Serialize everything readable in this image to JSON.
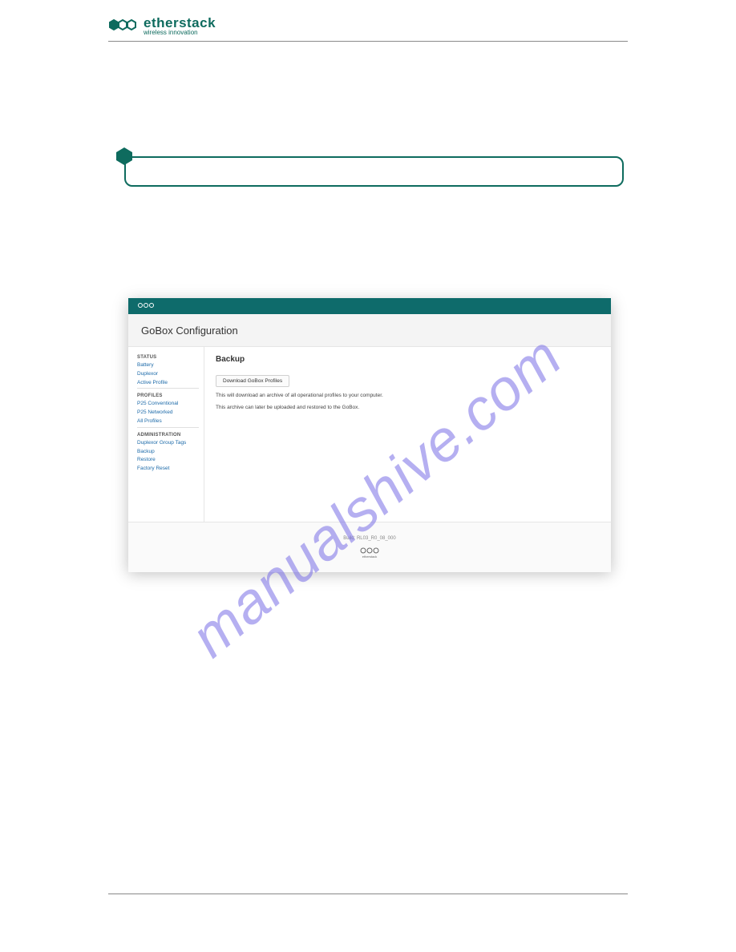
{
  "header": {
    "brand_main": "etherstack",
    "brand_sub": "wireless innovation"
  },
  "callout": {
    "text": ""
  },
  "screenshot": {
    "page_title": "GoBox Configuration",
    "sidebar": {
      "sections": [
        {
          "heading": "STATUS",
          "items": [
            "Battery",
            "Duplexor",
            "Active Profile"
          ]
        },
        {
          "heading": "PROFILES",
          "items": [
            "P25 Conventional",
            "P25 Networked",
            "All Profiles"
          ]
        },
        {
          "heading": "ADMINISTRATION",
          "items": [
            "Duplexor Group Tags",
            "Backup",
            "Restore",
            "Factory Reset"
          ]
        }
      ]
    },
    "main": {
      "title": "Backup",
      "button_label": "Download GoBox Profiles",
      "line1": "This will download an archive of all operational profiles to your computer.",
      "line2": "This archive can later be uploaded and restored to the GoBox."
    },
    "footer": {
      "build": "Build: RL03_R0_08_000",
      "brand": "etherstack"
    }
  },
  "watermark": "manualshive.com"
}
